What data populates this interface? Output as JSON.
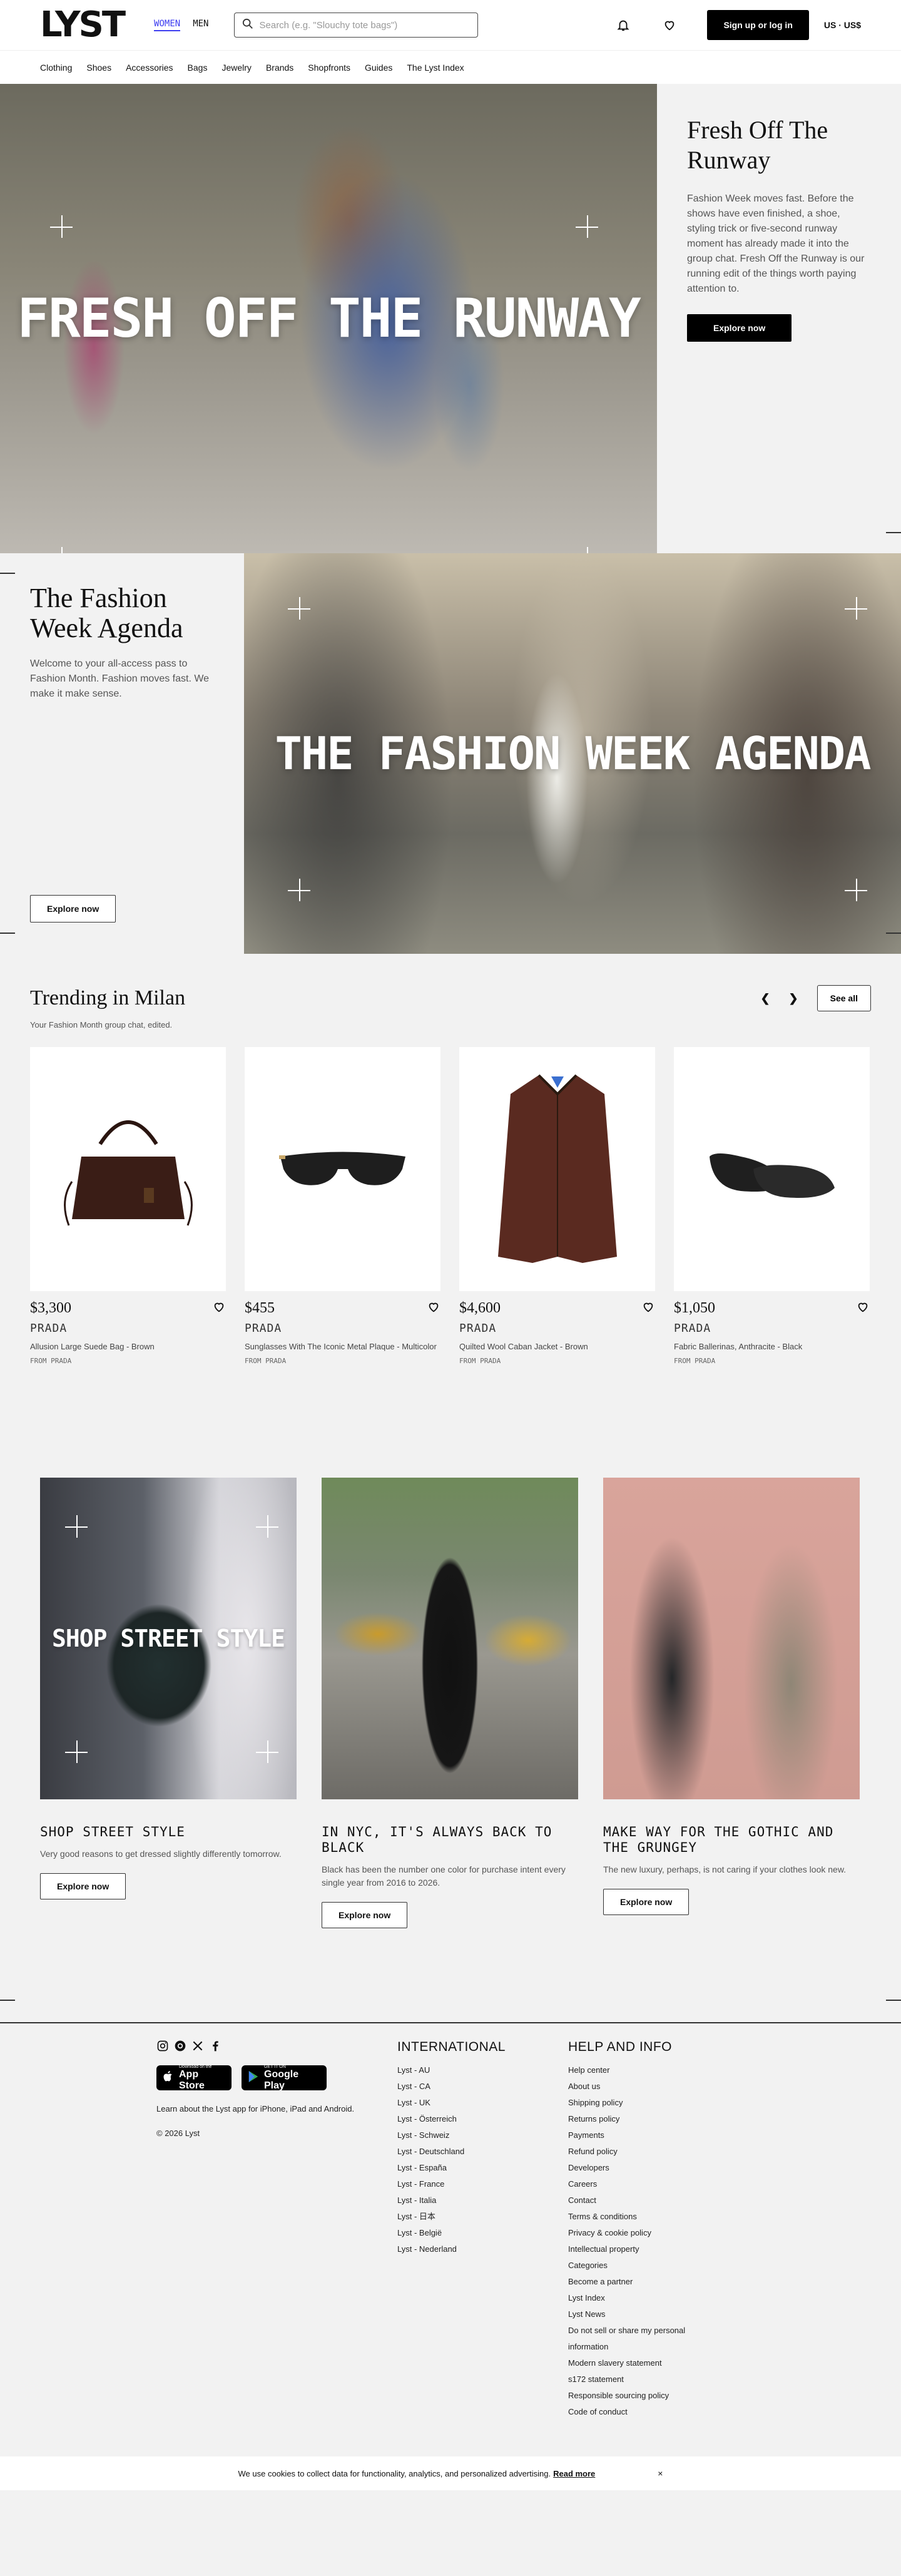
{
  "header": {
    "logo": "LYST",
    "gender_women": "WOMEN",
    "gender_men": "MEN",
    "search_placeholder": "Search (e.g. \"Slouchy tote bags\")",
    "signup_label": "Sign up or log in",
    "currency": "US · US$"
  },
  "nav": {
    "items": [
      "Clothing",
      "Shoes",
      "Accessories",
      "Bags",
      "Jewelry",
      "Brands",
      "Shopfronts",
      "Guides",
      "The Lyst Index"
    ]
  },
  "hero1": {
    "overlay": "FRESH OFF THE RUNWAY",
    "title": "Fresh Off The Runway",
    "body": "Fashion Week moves fast. Before the shows have even finished, a shoe, styling trick or five-second runway moment has already made it into the group chat. Fresh Off the Runway is our running edit of the things worth paying attention to.",
    "cta": "Explore now"
  },
  "hero2": {
    "overlay": "THE FASHION WEEK AGENDA",
    "title": "The Fashion Week Agenda",
    "body": "Welcome to your all-access pass to Fashion Month. Fashion moves fast. We make it make sense.",
    "cta": "Explore now"
  },
  "trending": {
    "title": "Trending in Milan",
    "subtitle": "Your Fashion Month group chat, edited.",
    "see_all": "See all",
    "products": [
      {
        "price": "$3,300",
        "brand": "PRADA",
        "name": "Allusion Large Suede Bag - Brown",
        "from": "FROM PRADA"
      },
      {
        "price": "$455",
        "brand": "PRADA",
        "name": "Sunglasses With The Iconic Metal Plaque - Multicolor",
        "from": "FROM PRADA"
      },
      {
        "price": "$4,600",
        "brand": "PRADA",
        "name": "Quilted Wool Caban Jacket - Brown",
        "from": "FROM PRADA"
      },
      {
        "price": "$1,050",
        "brand": "PRADA",
        "name": "Fabric Ballerinas, Anthracite - Black",
        "from": "FROM PRADA"
      }
    ]
  },
  "editorial": [
    {
      "overlay": "SHOP STREET STYLE",
      "title": "SHOP STREET STYLE",
      "body": "Very good reasons to get dressed slightly differently tomorrow.",
      "cta": "Explore now"
    },
    {
      "overlay": "",
      "title": "IN NYC, IT'S ALWAYS BACK TO BLACK",
      "body": "Black has been the number one color for purchase intent every single year from 2016 to 2026.",
      "cta": "Explore now"
    },
    {
      "overlay": "",
      "title": "MAKE WAY FOR THE GOTHIC AND THE GRUNGEY",
      "body": "The new luxury, perhaps, is not caring if your clothes look new.",
      "cta": "Explore now"
    }
  ],
  "footer": {
    "app_store_small": "Download on the",
    "app_store": "App Store",
    "google_play_small": "GET IT ON",
    "google_play": "Google Play",
    "app_text": "Learn about the Lyst app for iPhone, iPad and Android.",
    "copyright": "© 2026 Lyst",
    "international_title": "INTERNATIONAL",
    "international": [
      "Lyst - AU",
      "Lyst - CA",
      "Lyst - UK",
      "Lyst - Österreich",
      "Lyst - Schweiz",
      "Lyst - Deutschland",
      "Lyst - España",
      "Lyst - France",
      "Lyst - Italia",
      "Lyst - 日本",
      "Lyst - België",
      "Lyst - Nederland"
    ],
    "help_title": "HELP AND INFO",
    "help": [
      "Help center",
      "About us",
      "Shipping policy",
      "Returns policy",
      "Payments",
      "Refund policy",
      "Developers",
      "Careers",
      "Contact",
      "Terms & conditions",
      "Privacy & cookie policy",
      "Intellectual property",
      "Categories",
      "Become a partner",
      "Lyst Index",
      "Lyst News",
      "Do not sell or share my personal information",
      "Modern slavery statement",
      "s172 statement",
      "Responsible sourcing policy",
      "Code of conduct"
    ]
  },
  "cookie": {
    "text": "We use cookies to collect data for functionality, analytics, and personalized advertising.",
    "link": "Read more",
    "close": "×"
  },
  "colors": {
    "accent": "#3d3df0",
    "background": "#f2f2f2",
    "button": "#000000"
  }
}
